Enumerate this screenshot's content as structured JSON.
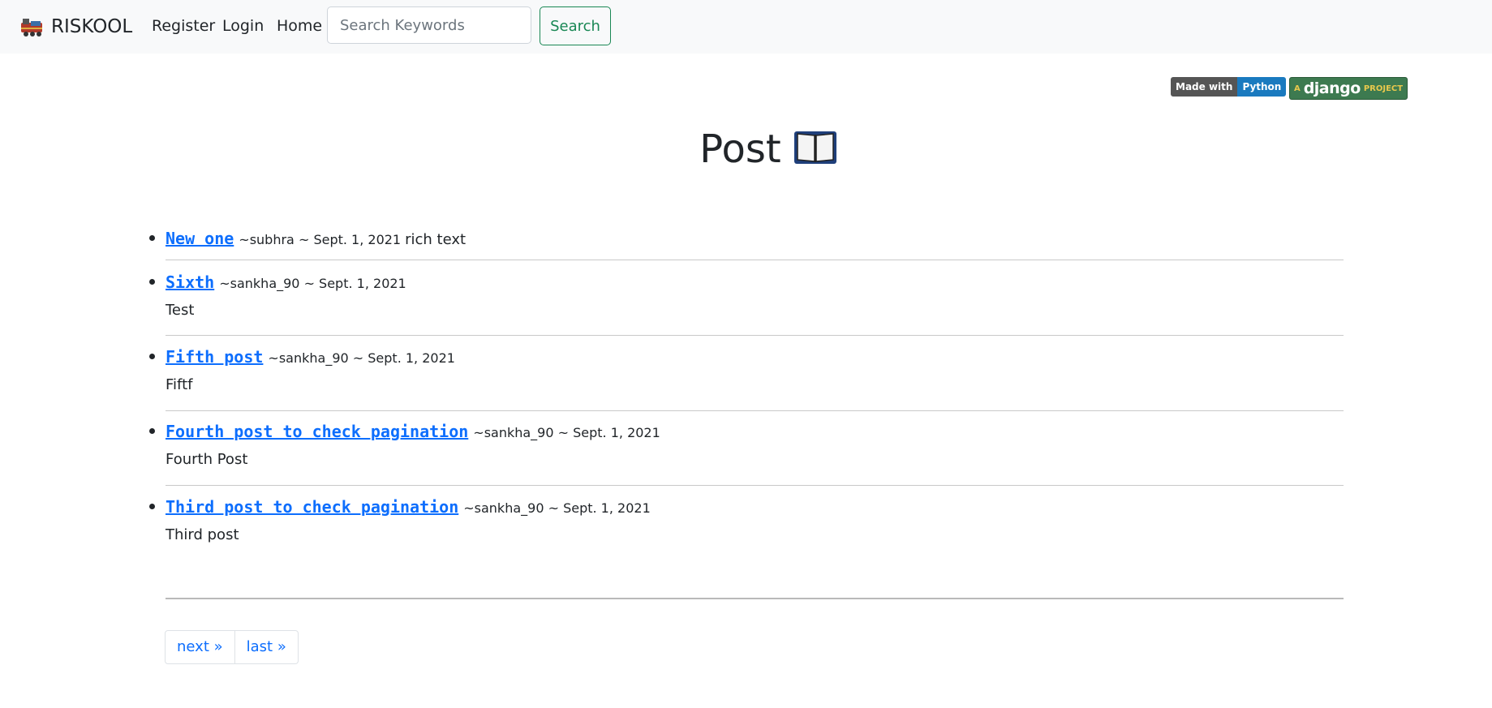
{
  "navbar": {
    "brand": "RISKOOL",
    "links": [
      "Register",
      "Login",
      "Home"
    ],
    "search": {
      "placeholder": "Search Keywords",
      "value": ""
    },
    "search_button": "Search"
  },
  "badges": {
    "python_left": "Made with",
    "python_right": "Python",
    "django_a": "A",
    "django_main": "django",
    "django_project": "PROJECT"
  },
  "page_title": "Post",
  "posts": [
    {
      "title": "New one",
      "meta": "~subhra ~ Sept. 1, 2021",
      "body": "rich text"
    },
    {
      "title": "Sixth",
      "meta": "~sankha_90 ~ Sept. 1, 2021",
      "body": "Test"
    },
    {
      "title": "Fifth post",
      "meta": "~sankha_90 ~ Sept. 1, 2021",
      "body": "Fiftf"
    },
    {
      "title": "Fourth post to check pagination",
      "meta": "~sankha_90 ~ Sept. 1, 2021",
      "body": "Fourth Post"
    },
    {
      "title": "Third post to check pagination",
      "meta": "~sankha_90 ~ Sept. 1, 2021",
      "body": "Third post"
    }
  ],
  "pagination": {
    "next": "next »",
    "last": "last »"
  }
}
